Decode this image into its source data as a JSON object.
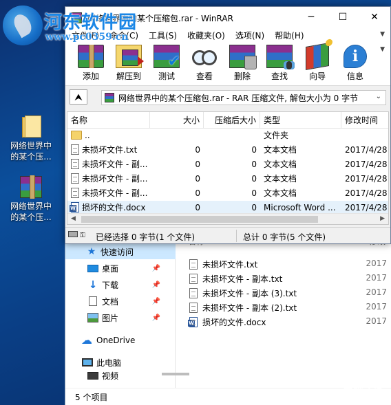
{
  "watermark": {
    "site_name": "河东软件园",
    "site_url": "www.pc0359.cn",
    "corner_title": "系统之家",
    "corner_url": "XITONGZHIJIA.NET"
  },
  "desktop": {
    "icons": [
      {
        "label": "网络世界中的某个压...",
        "icon": "folder-icon"
      },
      {
        "label": "网络世界中的某个压...",
        "icon": "winrar-archive-icon"
      }
    ]
  },
  "winrar": {
    "title": "网络世界中的某个压缩包.rar - WinRAR",
    "window_buttons": {
      "minimize": "─",
      "maximize": "☐",
      "close": "✕"
    },
    "menu": [
      "文件(F)",
      "命令(C)",
      "工具(S)",
      "收藏夹(O)",
      "选项(N)",
      "帮助(H)"
    ],
    "toolbar": [
      {
        "label": "添加",
        "icon": "add-icon"
      },
      {
        "label": "解压到",
        "icon": "extract-icon"
      },
      {
        "label": "测试",
        "icon": "test-icon"
      },
      {
        "label": "查看",
        "icon": "view-icon"
      },
      {
        "label": "删除",
        "icon": "delete-icon"
      },
      {
        "label": "查找",
        "icon": "find-icon"
      },
      {
        "label": "向导",
        "icon": "wizard-icon"
      },
      {
        "label": "信息",
        "icon": "info-icon"
      }
    ],
    "up_button": "⮝",
    "path": "网络世界中的某个压缩包.rar - RAR 压缩文件, 解包大小为 0 字节",
    "columns": [
      "名称",
      "大小",
      "压缩后大小",
      "类型",
      "修改时间"
    ],
    "rows": [
      {
        "name": "..",
        "size": "",
        "packed": "",
        "type": "文件夹",
        "modified": "",
        "icon": "folder-icon"
      },
      {
        "name": "未损坏文件.txt",
        "size": "0",
        "packed": "0",
        "type": "文本文档",
        "modified": "2017/4/28",
        "icon": "text-file-icon"
      },
      {
        "name": "未损坏文件 - 副...",
        "size": "0",
        "packed": "0",
        "type": "文本文档",
        "modified": "2017/4/28",
        "icon": "text-file-icon"
      },
      {
        "name": "未损坏文件 - 副...",
        "size": "0",
        "packed": "0",
        "type": "文本文档",
        "modified": "2017/4/28",
        "icon": "text-file-icon"
      },
      {
        "name": "未损坏文件 - 副...",
        "size": "0",
        "packed": "0",
        "type": "文本文档",
        "modified": "2017/4/28",
        "icon": "text-file-icon"
      },
      {
        "name": "损坏的文件.docx",
        "size": "0",
        "packed": "0",
        "type": "Microsoft Word ...",
        "modified": "2017/4/28",
        "icon": "word-file-icon"
      }
    ],
    "status_left": "已经选择 0 字节(1 个文件)",
    "status_right": "总计 0 字节(5 个文件)"
  },
  "explorer": {
    "header_name": "名称",
    "header_date": "修改",
    "nav": [
      {
        "label": "快速访问",
        "icon": "star-icon",
        "pinned": false
      },
      {
        "label": "桌面",
        "icon": "desktop-icon",
        "pinned": true
      },
      {
        "label": "下载",
        "icon": "download-icon",
        "pinned": true
      },
      {
        "label": "文档",
        "icon": "documents-icon",
        "pinned": true
      },
      {
        "label": "图片",
        "icon": "pictures-icon",
        "pinned": true
      },
      {
        "label": "OneDrive",
        "icon": "onedrive-icon",
        "pinned": false
      },
      {
        "label": "此电脑",
        "icon": "this-pc-icon",
        "pinned": false
      },
      {
        "label": "视频",
        "icon": "videos-icon",
        "pinned": false
      }
    ],
    "files": [
      {
        "name": "未损坏文件.txt",
        "date": "2017",
        "icon": "text-file-icon"
      },
      {
        "name": "未损坏文件 - 副本.txt",
        "date": "2017",
        "icon": "text-file-icon"
      },
      {
        "name": "未损坏文件 - 副本 (3).txt",
        "date": "2017",
        "icon": "text-file-icon"
      },
      {
        "name": "未损坏文件 - 副本 (2).txt",
        "date": "2017",
        "icon": "text-file-icon"
      },
      {
        "name": "损坏的文件.docx",
        "date": "2017",
        "icon": "word-file-icon"
      }
    ],
    "status": "5 个项目"
  }
}
